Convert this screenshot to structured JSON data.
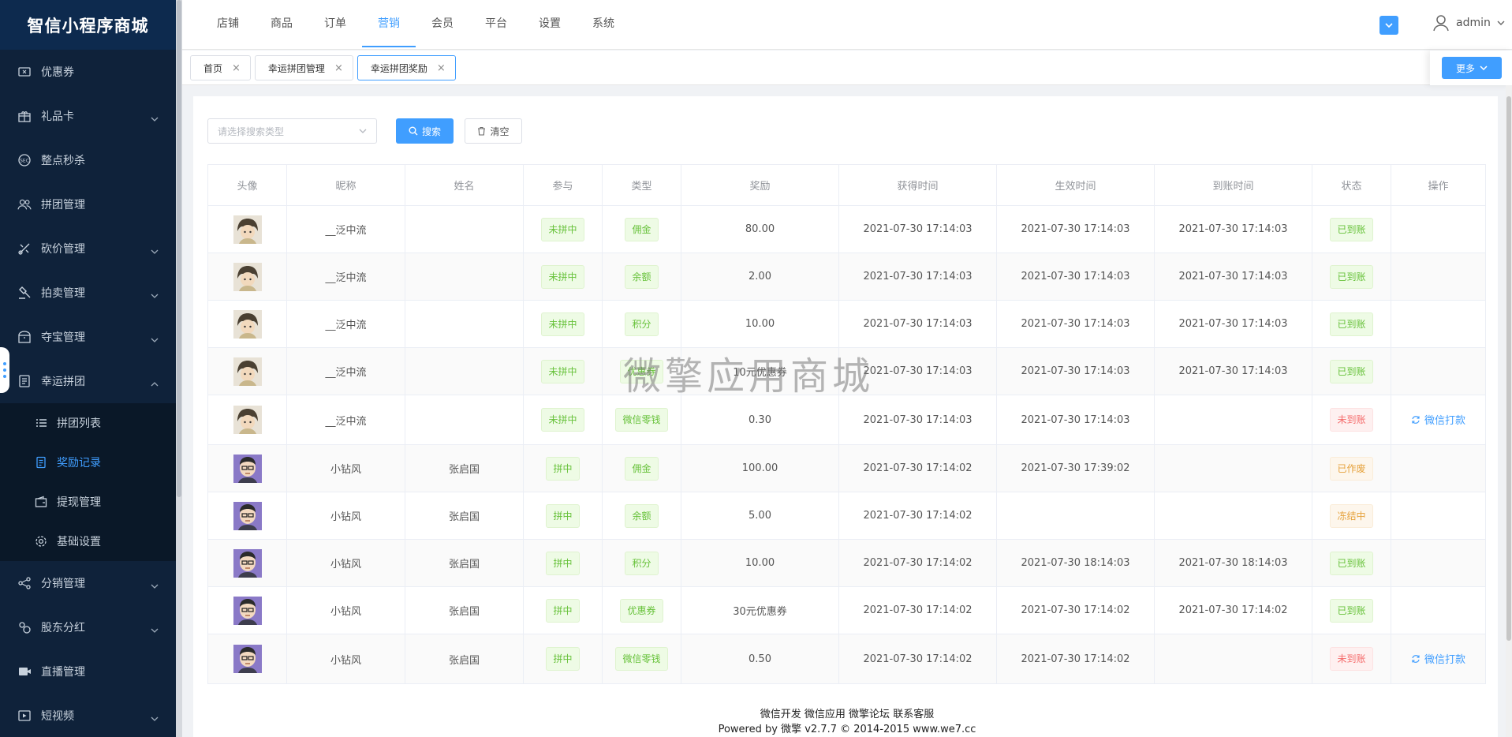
{
  "sidebar": {
    "brand": "智信小程序商城",
    "items": [
      {
        "label": "优惠券",
        "icon": "coupon-icon",
        "chevron": ""
      },
      {
        "label": "礼品卡",
        "icon": "gift-card-icon",
        "chevron": "down"
      },
      {
        "label": "整点秒杀",
        "icon": "flash-sale-icon",
        "chevron": ""
      },
      {
        "label": "拼团管理",
        "icon": "group-icon",
        "chevron": ""
      },
      {
        "label": "砍价管理",
        "icon": "bargain-icon",
        "chevron": "down"
      },
      {
        "label": "拍卖管理",
        "icon": "auction-icon",
        "chevron": "down"
      },
      {
        "label": "夺宝管理",
        "icon": "treasure-icon",
        "chevron": "down"
      },
      {
        "label": "幸运拼团",
        "icon": "lucky-group-icon",
        "chevron": "up"
      }
    ],
    "sub_items": [
      {
        "label": "拼团列表",
        "icon": "list-icon"
      },
      {
        "label": "奖励记录",
        "icon": "document-icon"
      },
      {
        "label": "提现管理",
        "icon": "wallet-icon"
      },
      {
        "label": "基础设置",
        "icon": "gear-icon"
      }
    ],
    "bottom_items": [
      {
        "label": "分销管理",
        "icon": "share-icon",
        "chevron": "down"
      },
      {
        "label": "股东分红",
        "icon": "dividend-icon",
        "chevron": "down"
      },
      {
        "label": "直播管理",
        "icon": "live-icon",
        "chevron": ""
      },
      {
        "label": "短视频",
        "icon": "video-icon",
        "chevron": "down"
      }
    ]
  },
  "topnav": [
    "店铺",
    "商品",
    "订单",
    "营销",
    "会员",
    "平台",
    "设置",
    "系统"
  ],
  "user": {
    "name": "admin"
  },
  "tabs": [
    {
      "label": "首页"
    },
    {
      "label": "幸运拼团管理"
    },
    {
      "label": "幸运拼团奖励"
    }
  ],
  "more_label": "更多",
  "search": {
    "placeholder": "请选择搜索类型",
    "search_label": "搜索",
    "clear_label": "清空"
  },
  "table": {
    "headers": [
      "头像",
      "昵称",
      "姓名",
      "参与",
      "类型",
      "奖励",
      "获得时间",
      "生效时间",
      "到账时间",
      "状态",
      "操作"
    ],
    "rows": [
      {
        "nickname": "__泛中流",
        "name": "",
        "participation": "未拼中",
        "type": "佣金",
        "reward": "80.00",
        "obtained": "2021-07-30 17:14:03",
        "effective": "2021-07-30 17:14:03",
        "arrival": "2021-07-30 17:14:03",
        "status": "已到账",
        "status_color": "green",
        "action": ""
      },
      {
        "nickname": "__泛中流",
        "name": "",
        "participation": "未拼中",
        "type": "余额",
        "reward": "2.00",
        "obtained": "2021-07-30 17:14:03",
        "effective": "2021-07-30 17:14:03",
        "arrival": "2021-07-30 17:14:03",
        "status": "已到账",
        "status_color": "green",
        "action": ""
      },
      {
        "nickname": "__泛中流",
        "name": "",
        "participation": "未拼中",
        "type": "积分",
        "reward": "10.00",
        "obtained": "2021-07-30 17:14:03",
        "effective": "2021-07-30 17:14:03",
        "arrival": "2021-07-30 17:14:03",
        "status": "已到账",
        "status_color": "green",
        "action": ""
      },
      {
        "nickname": "__泛中流",
        "name": "",
        "participation": "未拼中",
        "type": "优惠券",
        "reward": "10元优惠券",
        "obtained": "2021-07-30 17:14:03",
        "effective": "2021-07-30 17:14:03",
        "arrival": "2021-07-30 17:14:03",
        "status": "已到账",
        "status_color": "green",
        "action": ""
      },
      {
        "nickname": "__泛中流",
        "name": "",
        "participation": "未拼中",
        "type": "微信零钱",
        "reward": "0.30",
        "obtained": "2021-07-30 17:14:03",
        "effective": "2021-07-30 17:14:03",
        "arrival": "",
        "status": "未到账",
        "status_color": "red",
        "action": "微信打款"
      },
      {
        "nickname": "小钻风",
        "name": "张启国",
        "participation": "拼中",
        "type": "佣金",
        "reward": "100.00",
        "obtained": "2021-07-30 17:14:02",
        "effective": "2021-07-30 17:39:02",
        "arrival": "",
        "status": "已作废",
        "status_color": "orange",
        "action": ""
      },
      {
        "nickname": "小钻风",
        "name": "张启国",
        "participation": "拼中",
        "type": "余额",
        "reward": "5.00",
        "obtained": "2021-07-30 17:14:02",
        "effective": "",
        "arrival": "",
        "status": "冻结中",
        "status_color": "orange",
        "action": ""
      },
      {
        "nickname": "小钻风",
        "name": "张启国",
        "participation": "拼中",
        "type": "积分",
        "reward": "10.00",
        "obtained": "2021-07-30 17:14:02",
        "effective": "2021-07-30 18:14:03",
        "arrival": "2021-07-30 18:14:03",
        "status": "已到账",
        "status_color": "green",
        "action": ""
      },
      {
        "nickname": "小钻风",
        "name": "张启国",
        "participation": "拼中",
        "type": "优惠券",
        "reward": "30元优惠券",
        "obtained": "2021-07-30 17:14:02",
        "effective": "2021-07-30 17:14:02",
        "arrival": "2021-07-30 17:14:02",
        "status": "已到账",
        "status_color": "green",
        "action": ""
      },
      {
        "nickname": "小钻风",
        "name": "张启国",
        "participation": "拼中",
        "type": "微信零钱",
        "reward": "0.50",
        "obtained": "2021-07-30 17:14:02",
        "effective": "2021-07-30 17:14:02",
        "arrival": "",
        "status": "未到账",
        "status_color": "red",
        "action": "微信打款"
      }
    ]
  },
  "watermark": "微擎应用商城",
  "footer": {
    "links": "微信开发 微信应用 微擎论坛 联系客服",
    "powered": "Powered by 微擎 v2.7.7 © 2014-2015 www.we7.cc"
  },
  "colors": {
    "accent": "#409eff",
    "sidebar_bg": "#0f223a",
    "brand_bg": "#0d2a4e",
    "success": "#67c23a",
    "danger": "#f56c6c",
    "warning": "#e6a23c"
  }
}
